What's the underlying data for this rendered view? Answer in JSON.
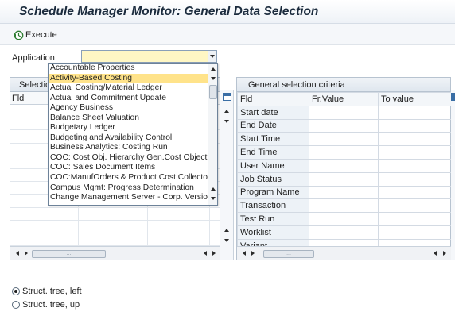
{
  "window": {
    "title": "Schedule Manager Monitor: General Data Selection"
  },
  "toolbar": {
    "execute_label": "Execute",
    "execute_icon": "execute-clock-icon"
  },
  "application": {
    "label": "Application",
    "value": "",
    "dropdown": {
      "selected": "Activity-Based Costing",
      "options": [
        "Accountable Properties",
        "Activity-Based Costing",
        "Actual Costing/Material Ledger",
        "Actual and Commitment Update",
        "Agency Business",
        "Balance Sheet Valuation",
        "Budgetary Ledger",
        "Budgeting and Availability Control",
        "Business Analytics: Costing Run",
        "COC: Cost Obj. Hierarchy Gen.Cost Object",
        "COC: Sales Document Items",
        "COC:ManufOrders & Product Cost Collector",
        "Campus Mgmt: Progress Determination",
        "Change Management Server - Corp. Version"
      ]
    }
  },
  "left_panel": {
    "header": "Selectio",
    "column_header": "Fld",
    "thumb_label": ":::"
  },
  "right_panel": {
    "header": "General selection criteria",
    "columns": [
      "Fld",
      "Fr.Value",
      "To value"
    ],
    "rows": [
      "Start date",
      "End Date",
      "Start Time",
      "End Time",
      "User Name",
      "Job Status",
      "Program Name",
      "Transaction",
      "Test Run",
      "Worklist",
      "Variant"
    ],
    "thumb_label": ":::"
  },
  "structure": {
    "options": [
      {
        "label": "Struct. tree, left",
        "selected": true
      },
      {
        "label": "Struct. tree, up",
        "selected": false
      }
    ]
  },
  "colors": {
    "dropdown_selected": "#ffe38a",
    "input_bg": "#fff7c4",
    "accent": "#3a6ea5"
  }
}
